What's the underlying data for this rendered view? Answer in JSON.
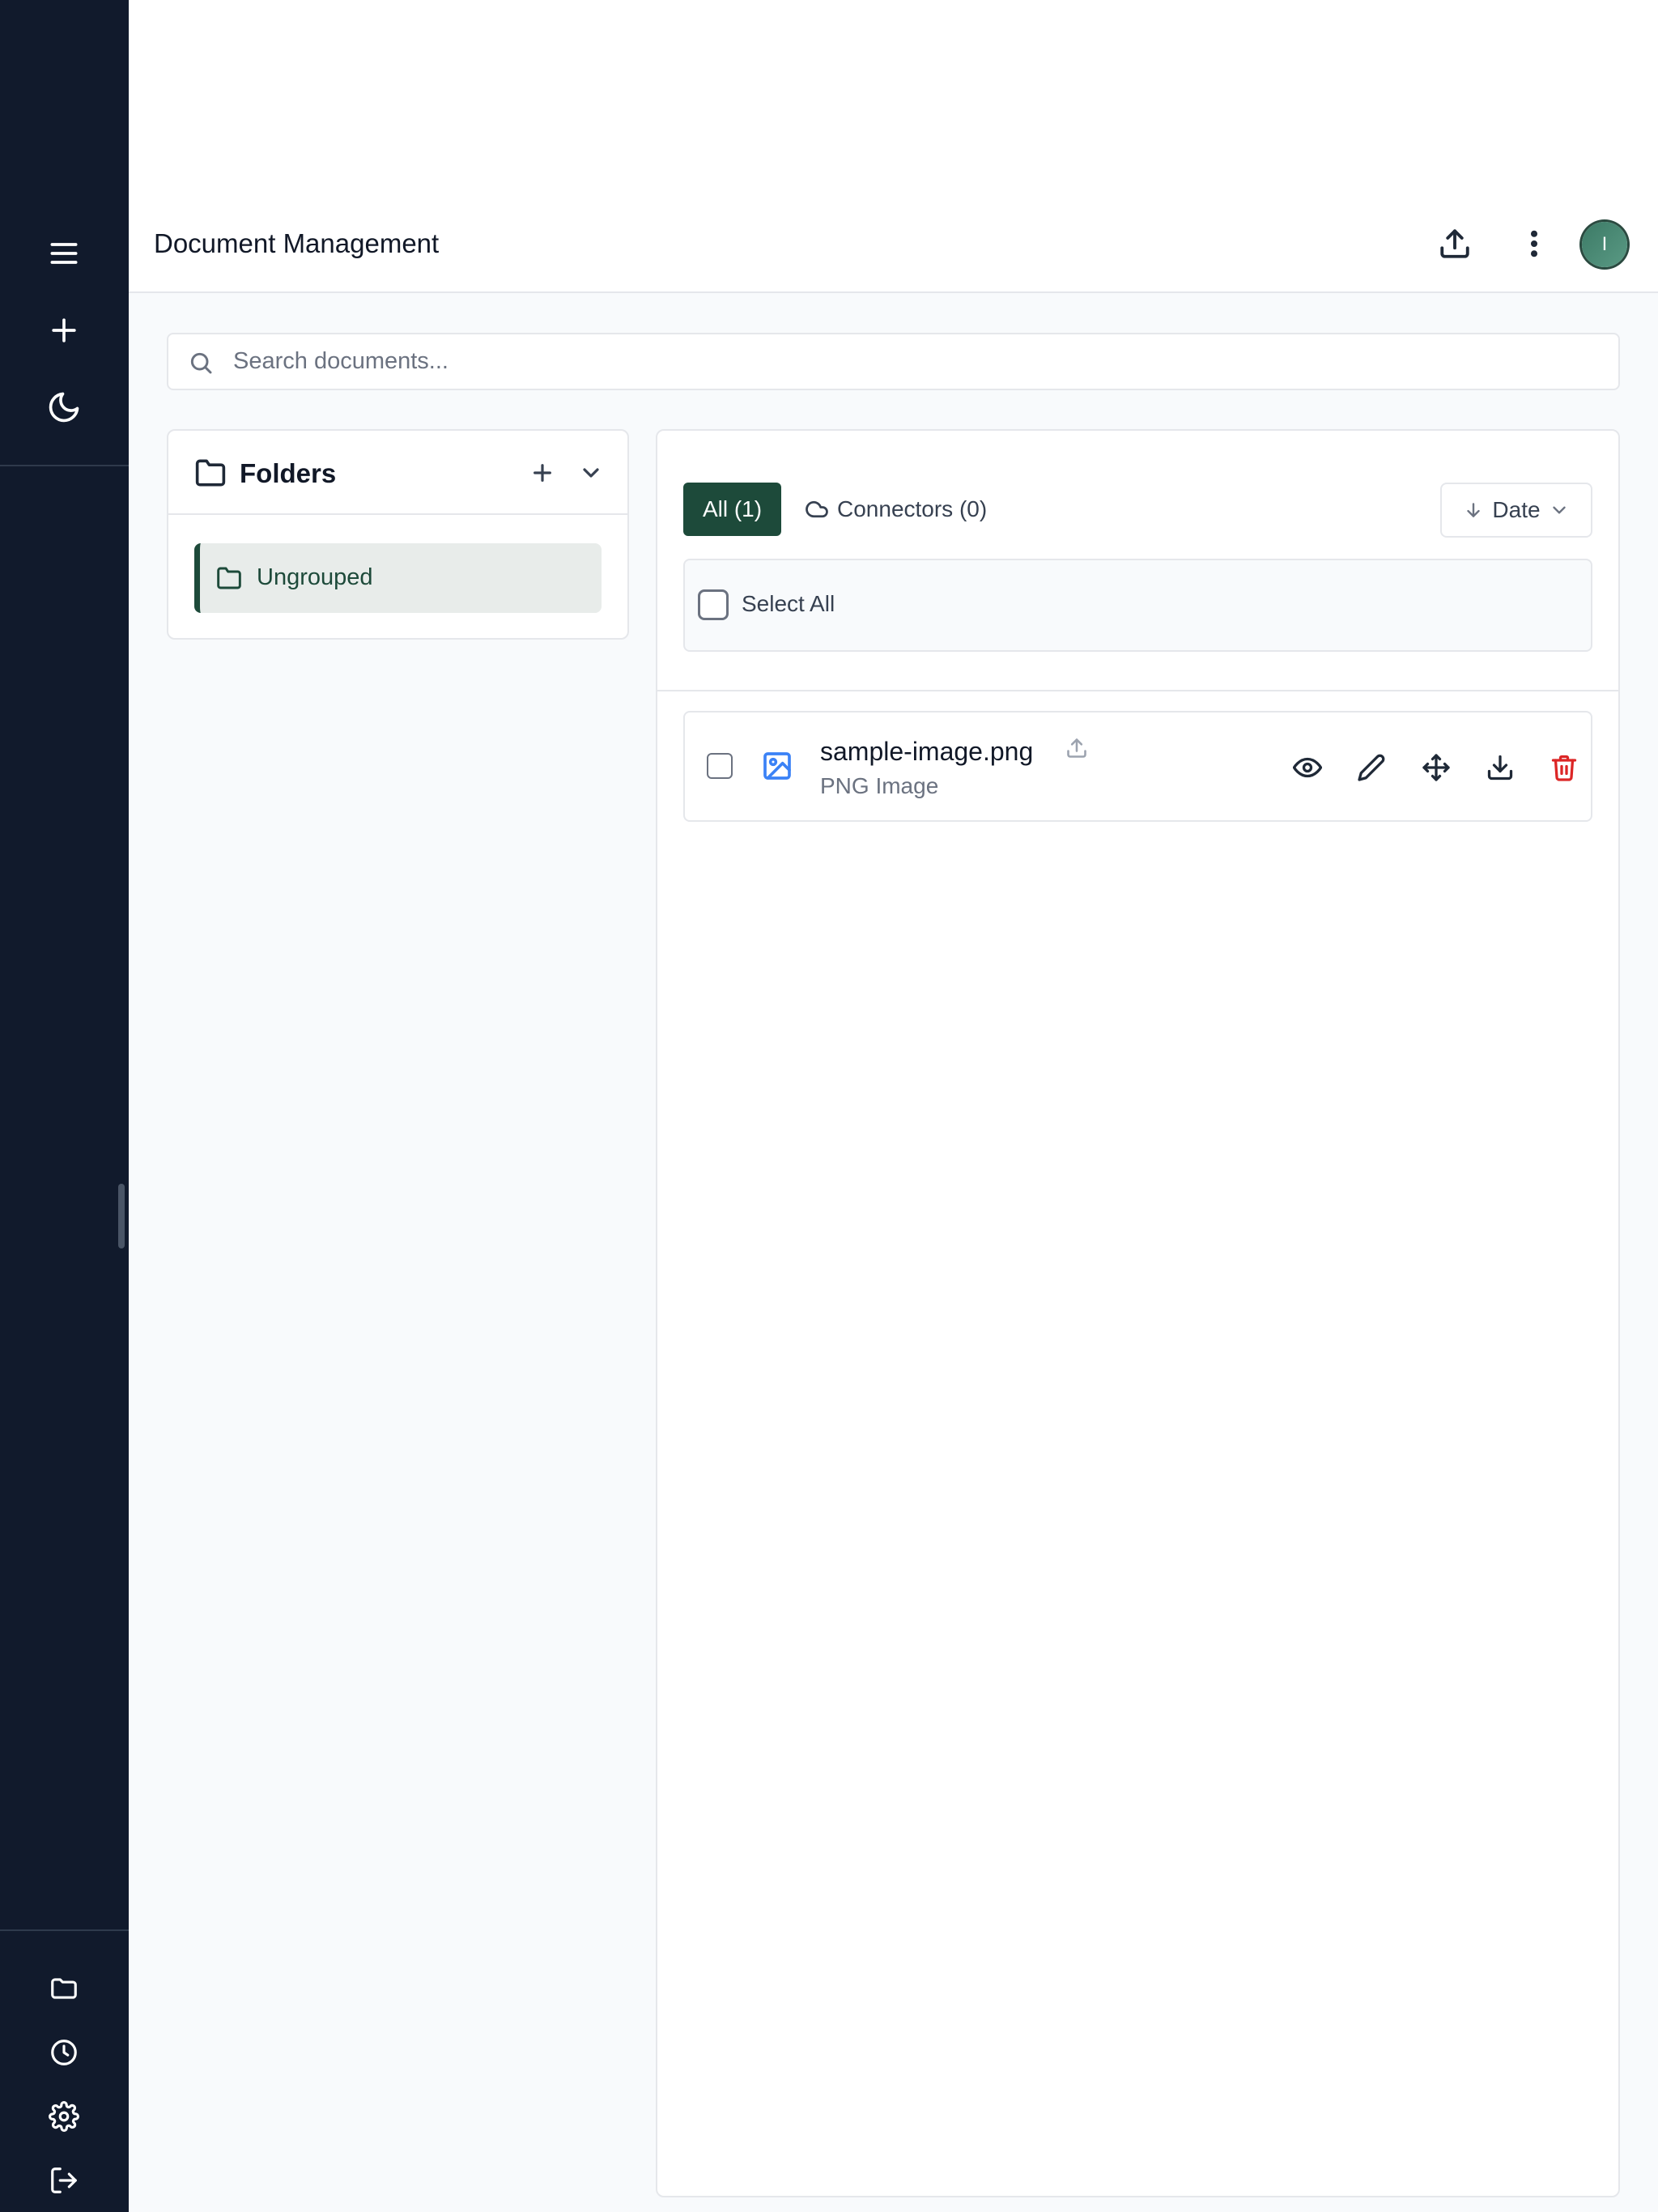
{
  "header": {
    "title": "Document Management",
    "avatar_initial": "I"
  },
  "search": {
    "value": "",
    "placeholder": "Search documents..."
  },
  "folders": {
    "title": "Folders",
    "items": [
      {
        "label": "Ungrouped",
        "selected": true
      }
    ]
  },
  "documents": {
    "tabs": [
      {
        "label": "All (1)",
        "active": true
      },
      {
        "label": "Connectors (0)",
        "active": false
      }
    ],
    "sort": {
      "label": "Date"
    },
    "select_all_label": "Select All",
    "items": [
      {
        "name": "sample-image.png",
        "type": "PNG Image"
      }
    ]
  },
  "icons": {
    "rail_top": [
      "menu-icon",
      "plus-icon",
      "moon-icon"
    ],
    "rail_bottom": [
      "folder-icon",
      "clock-icon",
      "gear-icon",
      "logout-icon"
    ],
    "header": [
      "upload-icon",
      "more-vertical-icon"
    ],
    "doc_actions": [
      "eye-icon",
      "pencil-icon",
      "move-icon",
      "download-icon",
      "trash-icon"
    ]
  },
  "colors": {
    "rail": "#111a2c",
    "accent": "#1d4a3a",
    "image_icon": "#3b82f6",
    "danger": "#dc2626"
  }
}
